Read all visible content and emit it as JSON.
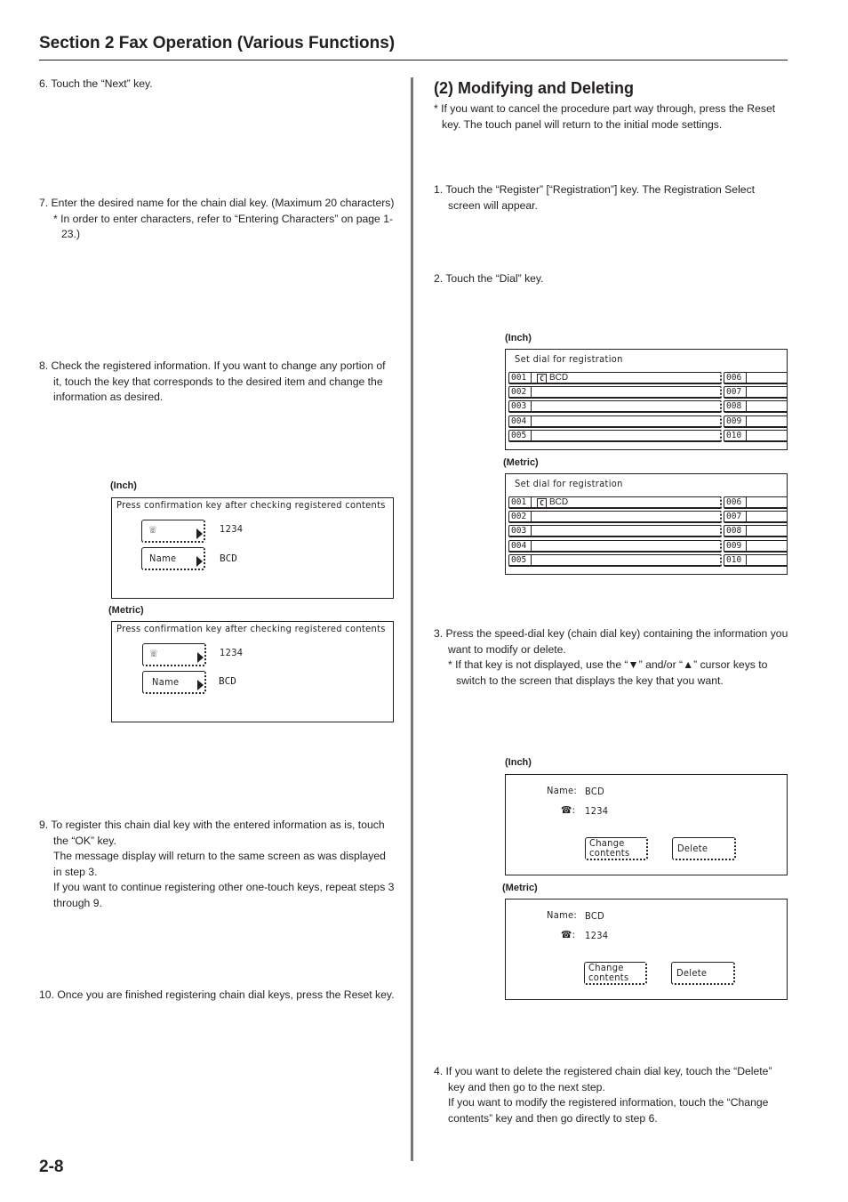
{
  "header": {
    "title": "Section 2  Fax Operation (Various Functions)"
  },
  "footer": {
    "page_number": "2-8"
  },
  "left_column": {
    "step6": "6. Touch the “Next” key.",
    "step7": {
      "main": "7. Enter the desired name for the chain dial key. (Maximum 20 characters)",
      "note": "* In order to enter characters, refer to “Entering Characters” on page 1-23.)"
    },
    "step8": "8. Check the registered information. If you want to change any portion of it, touch the key that corresponds to the desired item and change the information as desired.",
    "confirm_screens": [
      {
        "caption": "(Inch)",
        "title": "Press confirmation key after checking registered contents",
        "phone_icon": "telephone-icon",
        "phone_value": "1234",
        "name_key": "Name",
        "name_value": "BCD"
      },
      {
        "caption": "(Metric)",
        "title": "Press confirmation key after checking registered contents",
        "phone_icon": "telephone-icon",
        "phone_value": "1234",
        "name_key": "Name",
        "name_value": "BCD"
      }
    ],
    "step9": {
      "main": "9. To register this chain dial key with the entered information as is, touch the “OK” key.",
      "line2": "The message display will return to the same screen as was displayed in step 3.",
      "line3": "If you want to continue registering other one-touch keys, repeat steps 3 through 9."
    },
    "step10": "10. Once you are finished registering chain dial keys, press the Reset key."
  },
  "right_column": {
    "section_title": "(2) Modifying and Deleting",
    "intro_note": "* If you want to cancel the procedure part way through, press the Reset key. The touch panel will return to the initial mode settings.",
    "step1": "1. Touch the “Register” [“Registration”] key. The Registration Select screen will appear.",
    "step2": "2. Touch the “Dial” key.",
    "dial_screens": [
      {
        "caption": "(Inch)",
        "title": "Set dial for registration",
        "left_keys": [
          {
            "num": "001",
            "icon": "C",
            "label": "BCD"
          },
          {
            "num": "002",
            "icon": "",
            "label": ""
          },
          {
            "num": "003",
            "icon": "",
            "label": ""
          },
          {
            "num": "004",
            "icon": "",
            "label": ""
          },
          {
            "num": "005",
            "icon": "",
            "label": ""
          }
        ],
        "right_keys": [
          "006",
          "007",
          "008",
          "009",
          "010"
        ]
      },
      {
        "caption": "(Metric)",
        "title": "Set dial for registration",
        "left_keys": [
          {
            "num": "001",
            "icon": "C",
            "label": "BCD"
          },
          {
            "num": "002",
            "icon": "",
            "label": ""
          },
          {
            "num": "003",
            "icon": "",
            "label": ""
          },
          {
            "num": "004",
            "icon": "",
            "label": ""
          },
          {
            "num": "005",
            "icon": "",
            "label": ""
          }
        ],
        "right_keys": [
          "006",
          "007",
          "008",
          "009",
          "010"
        ]
      }
    ],
    "step3": {
      "main": "3. Press the speed-dial key (chain dial key) containing the information you want to modify or delete.",
      "note": "* If that key is not displayed, use the “▼” and/or “▲” cursor keys to switch to the screen that displays the key that you want."
    },
    "detail_screens": [
      {
        "caption": "(Inch)",
        "name_label": "Name:",
        "name_value": "BCD",
        "phone_label": "☎:",
        "phone_value": "1234",
        "change_button": "Change contents",
        "delete_button": "Delete"
      },
      {
        "caption": "(Metric)",
        "name_label": "Name:",
        "name_value": "BCD",
        "phone_label": "☎:",
        "phone_value": "1234",
        "change_button": "Change contents",
        "delete_button": "Delete"
      }
    ],
    "step4": {
      "main": "4. If you want to delete the registered chain dial key, touch the “Delete” key and then go to the next step.",
      "line2": "If you want to modify the registered information, touch the “Change contents” key and then go directly to step 6."
    }
  }
}
